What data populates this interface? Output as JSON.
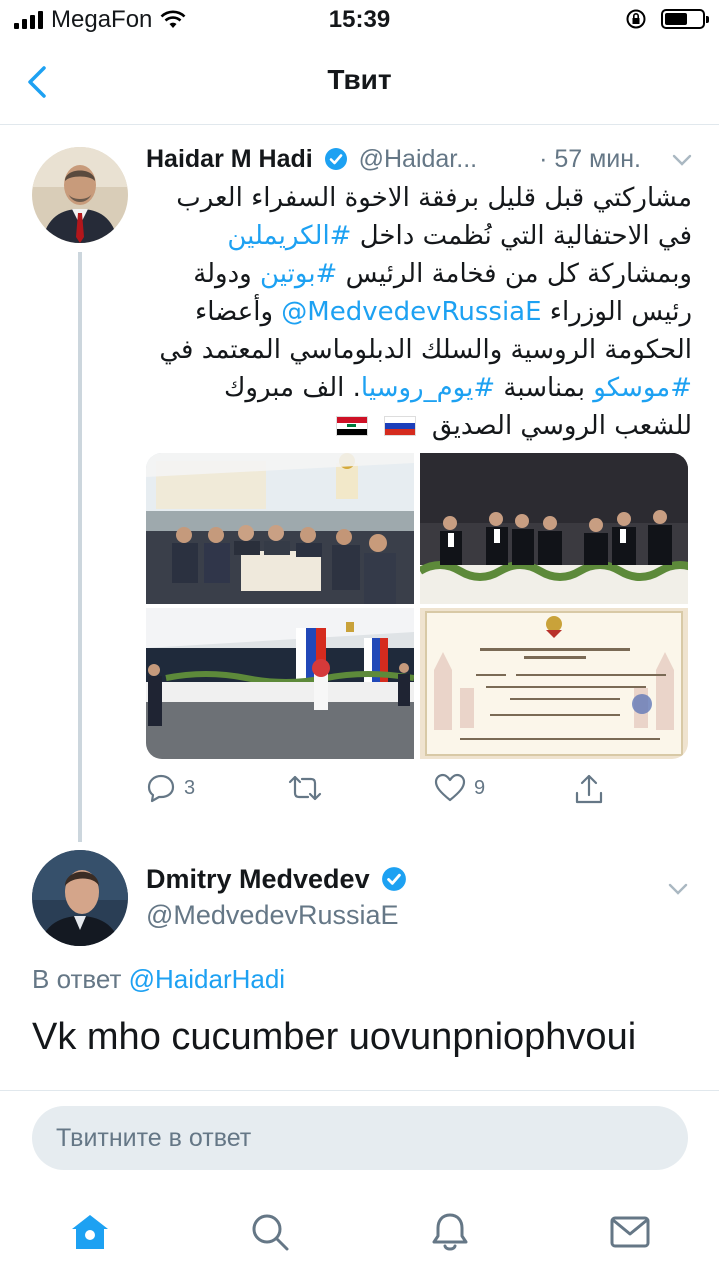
{
  "status_bar": {
    "carrier": "MegaFon",
    "time": "15:39"
  },
  "nav": {
    "title": "Твит"
  },
  "tweet1": {
    "name": "Haidar M Hadi",
    "handle": "@Haidar...",
    "time": "· 57 мин.",
    "text_segments": [
      {
        "t": "مشاركتي قبل قليل برفقة الاخوة السفراء العرب في الاحتفالية التي نُظمت داخل ",
        "link": false
      },
      {
        "t": "#الكريملين",
        "link": true
      },
      {
        "t": " وبمشاركة كل من فخامة الرئيس ",
        "link": false
      },
      {
        "t": "#بوتين",
        "link": true
      },
      {
        "t": " ودولة رئيس الوزراء ",
        "link": false
      },
      {
        "t": "@MedvedevRussiaE",
        "link": true
      },
      {
        "t": " وأعضاء الحكومة الروسية والسلك الدبلوماسي المعتمد في ",
        "link": false
      },
      {
        "t": "#موسكو",
        "link": true
      },
      {
        "t": " بمناسبة ",
        "link": false
      },
      {
        "t": "#يوم_روسيا",
        "link": true
      },
      {
        "t": ". الف مبروك للشعب الروسي الصديق",
        "link": false
      }
    ],
    "invitation": {
      "line1": "Президент Российской Федерации",
      "line2": "В.В.Путин",
      "line3": "приглашает",
      "line4": "Е.П.г. Х.М.Х.Ависа",
      "line5": "на торжественный прием по случаю празднования Дня России",
      "line6": "в среду, 12 июня 2019 года, в 18.30",
      "line7": "Московский Кремль, Ивановская площадь"
    },
    "actions": {
      "replies": "3",
      "retweets": "",
      "likes": "9"
    }
  },
  "tweet2": {
    "name": "Dmitry Medvedev",
    "handle": "@MedvedevRussiaE",
    "reply_prefix": "В ответ",
    "reply_to": "@HaidarHadi",
    "text": "Vk mho cucumber uovunpniophvoui"
  },
  "composer": {
    "placeholder": "Твитните в ответ"
  },
  "colors": {
    "accent": "#1da1f2",
    "muted": "#657786",
    "divider": "#e1e8ed"
  }
}
